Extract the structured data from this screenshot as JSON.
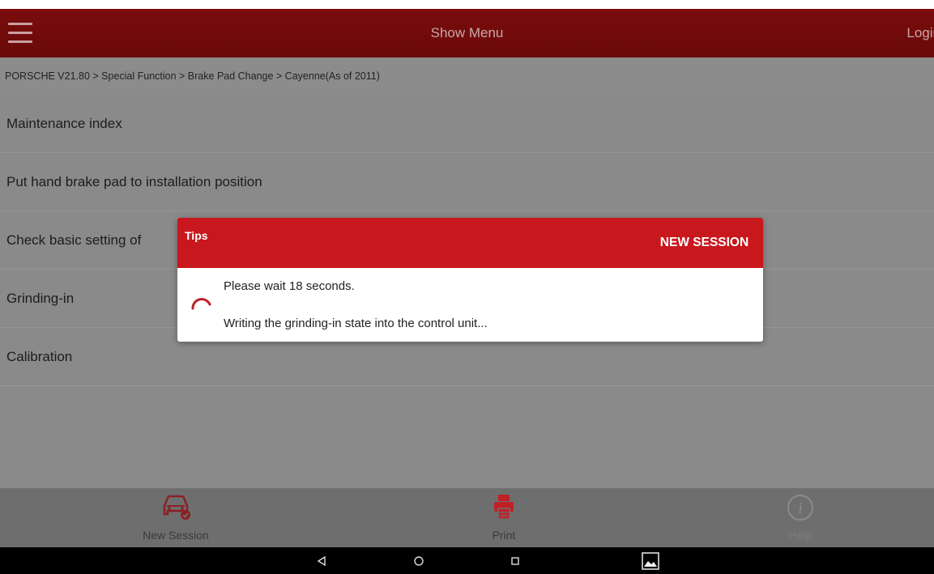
{
  "header": {
    "title": "Show Menu",
    "login_label": "Login"
  },
  "breadcrumb": "PORSCHE V21.80 > Special Function > Brake Pad Change > Cayenne(As of 2011)",
  "menu_items": [
    {
      "label": "Maintenance index"
    },
    {
      "label": "Put hand brake pad to installation position"
    },
    {
      "label": "Check basic setting of"
    },
    {
      "label": "Grinding-in"
    },
    {
      "label": "Calibration"
    }
  ],
  "dialog": {
    "title": "Tips",
    "action_label": "NEW SESSION",
    "line1": "Please wait 18 seconds.",
    "line2": "Writing the grinding-in state into the control unit..."
  },
  "toolbar": {
    "new_session_label": "New Session",
    "print_label": "Print",
    "help_label": "Help"
  },
  "icons": {
    "menu": "hamburger-icon",
    "new_session": "car-icon",
    "print": "printer-icon",
    "help": "info-icon",
    "back": "back-triangle-icon",
    "home": "home-circle-icon",
    "recents": "recents-square-icon",
    "screenshot": "image-icon"
  },
  "colors": {
    "header": "#7a0c0c",
    "dialog_header": "#c8171d",
    "accent_red": "#c02026"
  }
}
